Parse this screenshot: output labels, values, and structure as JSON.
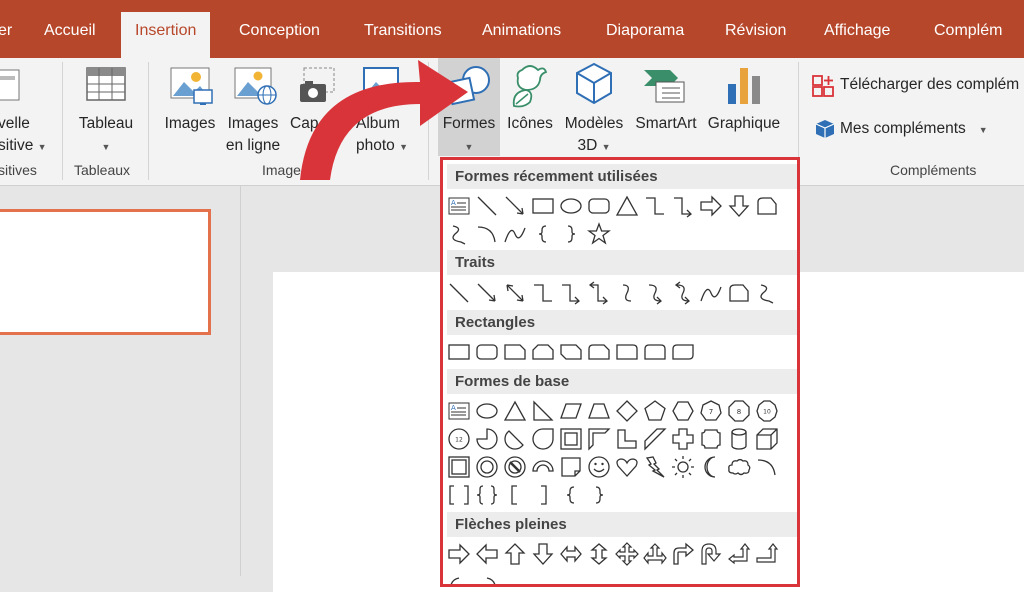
{
  "tabs": {
    "fichier": "er",
    "accueil": "Accueil",
    "insertion": "Insertion",
    "conception": "Conception",
    "transitions": "Transitions",
    "animations": "Animations",
    "diaporama": "Diaporama",
    "revision": "Révision",
    "affichage": "Affichage",
    "complements": "Complém"
  },
  "ribbon": {
    "nouvelle_line1": "velle",
    "nouvelle_line2": "sitive",
    "group_diapositives": "sitives",
    "tableau": "Tableau",
    "group_tableaux": "Tableaux",
    "images": "Images",
    "images_en_ligne_1": "Images",
    "images_en_ligne_2": "en ligne",
    "capture": "Cap",
    "album_1": "Album",
    "album_2": "photo",
    "group_images": "Images",
    "formes": "Formes",
    "icones": "Icônes",
    "modeles_1": "Modèles",
    "modeles_2": "3D",
    "smartart": "SmartArt",
    "graphique": "Graphique",
    "telecharger": "Télécharger des complém",
    "mes_complements": "Mes compléments",
    "group_complements": "Compléments"
  },
  "dropdown": {
    "recent_title": "Formes récemment utilisées",
    "traits_title": "Traits",
    "rect_title": "Rectangles",
    "base_title": "Formes de base",
    "fleches_title": "Flèches pleines",
    "recent_row1": [
      "text-box-shape",
      "line-shape",
      "arrow-line-shape",
      "rectangle-shape",
      "oval-shape",
      "rounded-rect-shape",
      "triangle-shape",
      "elbow-connector-shape",
      "elbow-arrow-shape",
      "right-arrow-shape",
      "down-arrow-shape",
      "snip-rect-shape"
    ],
    "recent_row2": [
      "freeform-shape",
      "arc-shape",
      "curve-shape",
      "left-brace-shape",
      "right-brace-shape",
      "star-shape"
    ],
    "traits_row": [
      "line-shape",
      "arrow-line-shape",
      "double-arrow-line-shape",
      "elbow-connector-shape",
      "elbow-arrow-shape",
      "elbow-double-arrow-shape",
      "curved-connector-shape",
      "curved-arrow-shape",
      "curved-double-arrow-shape",
      "curve-shape",
      "freeform-shape",
      "scribble-shape"
    ],
    "rect_row": [
      "rectangle-shape",
      "rounded-rect-shape",
      "snip-corner-shape",
      "snip-same-shape",
      "snip-diagonal-shape",
      "snip-round-shape",
      "round-corner-shape",
      "round-same-shape",
      "round-diagonal-shape"
    ],
    "base_row1": [
      "text-box-shape",
      "oval-shape",
      "triangle-shape",
      "right-triangle-shape",
      "parallelogram-shape",
      "trapezoid-shape",
      "diamond-shape",
      "pentagon-shape",
      "hexagon-shape",
      "heptagon-shape",
      "octagon-shape",
      "decagon-shape"
    ],
    "base_row2": [
      "dodecagon-shape",
      "pie-shape",
      "chord-shape",
      "teardrop-shape",
      "frame-shape",
      "half-frame-shape",
      "l-shape",
      "diagonal-stripe-shape",
      "cross-shape",
      "plaque-shape",
      "can-shape",
      "cube-shape"
    ],
    "base_row3": [
      "bevel-shape",
      "donut-shape",
      "no-symbol-shape",
      "block-arc-shape",
      "folded-corner-shape",
      "smiley-shape",
      "heart-shape",
      "lightning-shape",
      "sun-shape",
      "moon-shape",
      "cloud-shape",
      "arc-shape"
    ],
    "base_row4": [
      "double-bracket-shape",
      "double-brace-shape",
      "left-bracket-shape",
      "right-bracket-shape",
      "left-brace-shape",
      "right-brace-shape"
    ],
    "fleches_row1": [
      "right-arrow-shape",
      "left-arrow-shape",
      "up-arrow-shape",
      "down-arrow-shape",
      "left-right-arrow-shape",
      "up-down-arrow-shape",
      "quad-arrow-shape",
      "left-right-up-arrow-shape",
      "bent-arrow-shape",
      "u-turn-arrow-shape",
      "left-up-arrow-shape",
      "bent-up-arrow-shape"
    ],
    "heptagon_label": "7",
    "octagon_label": "8",
    "decagon_label": "10",
    "dodecagon_label": "12"
  },
  "colors": {
    "accent": "#b7472a",
    "dropdown_border": "#d9343a",
    "thumb_border": "#e3714b",
    "callout_arrow": "#d9343a"
  }
}
